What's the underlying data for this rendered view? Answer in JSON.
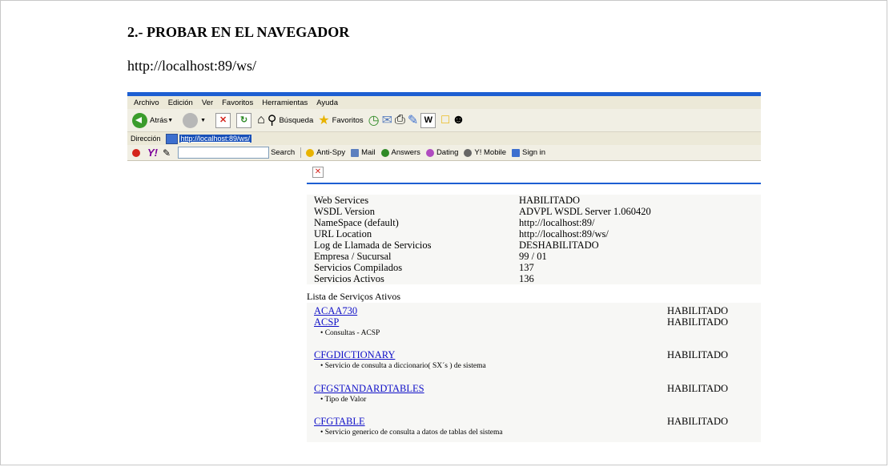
{
  "document": {
    "heading": "2.- PROBAR EN EL NAVEGADOR",
    "url": "http://localhost:89/ws/"
  },
  "browser": {
    "menu": [
      "Archivo",
      "Edición",
      "Ver",
      "Favoritos",
      "Herramientas",
      "Ayuda"
    ],
    "toolbar": {
      "back_label": "Atrás",
      "search_label": "Búsqueda",
      "favorites_label": "Favoritos"
    },
    "address": {
      "label": "Dirección",
      "value": "http://localhost:89/ws/"
    },
    "yahoo": {
      "search_label": "Search",
      "antispy_label": "Anti-Spy",
      "mail_label": "Mail",
      "answers_label": "Answers",
      "dating_label": "Dating",
      "mobile_label": "Y! Mobile",
      "signin_label": "Sign in"
    }
  },
  "info_rows": [
    {
      "label": "Web Services",
      "value": "HABILITADO"
    },
    {
      "label": "WSDL Version",
      "value": "ADVPL WSDL Server 1.060420"
    },
    {
      "label": "NameSpace (default)",
      "value": "http://localhost:89/"
    },
    {
      "label": "URL Location",
      "value": "http://localhost:89/ws/"
    },
    {
      "label": "Log de Llamada de Servicios",
      "value": "DESHABILITADO"
    },
    {
      "label": "Empresa / Sucursal",
      "value": "99 / 01"
    },
    {
      "label": "Servicios Compilados",
      "value": "137"
    },
    {
      "label": "Servicios Activos",
      "value": "136"
    }
  ],
  "services_title": "Lista de Serviços Ativos",
  "services": [
    {
      "name": "ACAA730",
      "status": "HABILITADO",
      "description": ""
    },
    {
      "name": "ACSP",
      "status": "HABILITADO",
      "description": "• Consultas - ACSP"
    },
    {
      "name": "CFGDICTIONARY",
      "status": "HABILITADO",
      "description": "• Servicio de consulta a diccionario( SX´s ) de sistema"
    },
    {
      "name": "CFGSTANDARDTABLES",
      "status": "HABILITADO",
      "description": "• Tipo de Valor"
    },
    {
      "name": "CFGTABLE",
      "status": "HABILITADO",
      "description": "• Servicio generico de consulta a datos de tablas del sistema"
    }
  ]
}
